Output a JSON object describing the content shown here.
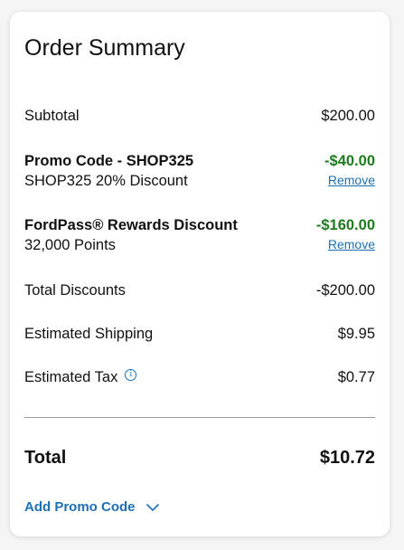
{
  "summary": {
    "title": "Order Summary",
    "subtotal": {
      "label": "Subtotal",
      "value": "$200.00"
    },
    "promo": {
      "label": "Promo Code - SHOP325",
      "description": "SHOP325 20% Discount",
      "value": "-$40.00",
      "remove_label": "Remove"
    },
    "rewards": {
      "label": "FordPass® Rewards Discount",
      "description": "32,000 Points",
      "value": "-$160.00",
      "remove_label": "Remove"
    },
    "total_discounts": {
      "label": "Total Discounts",
      "value": "-$200.00"
    },
    "shipping": {
      "label": "Estimated Shipping",
      "value": "$9.95"
    },
    "tax": {
      "label": "Estimated Tax",
      "value": "$0.77",
      "info_icon": "i"
    },
    "total": {
      "label": "Total",
      "value": "$10.72"
    },
    "add_promo_label": "Add Promo Code"
  },
  "colors": {
    "discount": "#1f7a1f",
    "link": "#1e6fb5"
  }
}
